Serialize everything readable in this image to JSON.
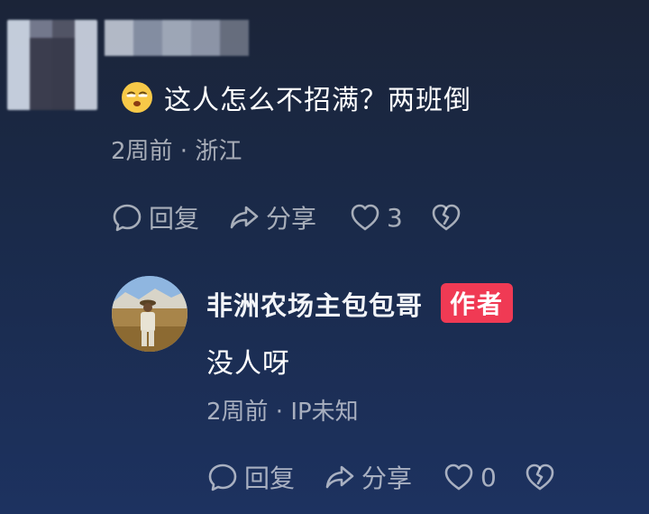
{
  "comment": {
    "emoji": "unamused-face-icon",
    "text": "这人怎么不招满？两班倒",
    "meta": "2周前 · 浙江",
    "actions": {
      "reply_label": "回复",
      "share_label": "分享",
      "like_count": "3"
    }
  },
  "reply": {
    "author_name": "非洲农场主包包哥",
    "author_badge": "作者",
    "text": "没人呀",
    "meta": "2周前 · IP未知",
    "actions": {
      "reply_label": "回复",
      "share_label": "分享",
      "like_count": "0"
    }
  },
  "colors": {
    "badge": "#f03a54",
    "muted_text": "#a3a8b3"
  }
}
